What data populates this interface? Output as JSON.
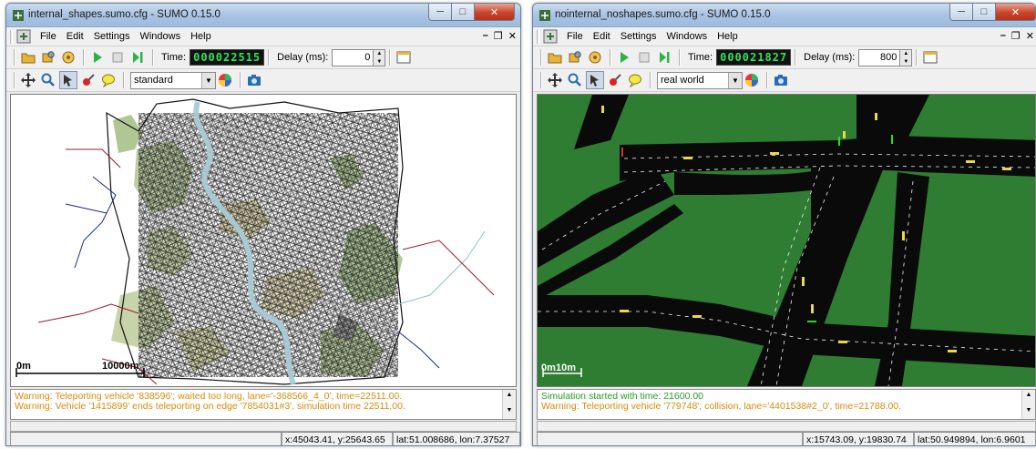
{
  "windows": [
    {
      "title": "internal_shapes.sumo.cfg - SUMO 0.15.0",
      "menu": [
        "File",
        "Edit",
        "Settings",
        "Windows",
        "Help"
      ],
      "time_label": "Time:",
      "time_value": "000022515",
      "delay_label": "Delay (ms):",
      "delay_value": "0",
      "scheme": "standard",
      "scale_start": "0m",
      "scale_end": "10000m",
      "messages": [
        {
          "type": "warn",
          "text": "Warning: Teleporting vehicle '838596'; waited too long, lane='-368566_4_0', time=22511.00."
        },
        {
          "type": "warn",
          "text": "Warning: Vehicle '1415899' ends teleporting on edge '7854031#3', simulation time 22511.00."
        }
      ],
      "status_xy": "x:45043.41, y:25643.65",
      "status_latlon": "lat:51.008686, lon:7.37527"
    },
    {
      "title": "nointernal_noshapes.sumo.cfg - SUMO 0.15.0",
      "menu": [
        "File",
        "Edit",
        "Settings",
        "Windows",
        "Help"
      ],
      "time_label": "Time:",
      "time_value": "000021827",
      "delay_label": "Delay (ms):",
      "delay_value": "800",
      "scheme": "real world",
      "scale_start": "0m",
      "scale_end": "10m",
      "messages": [
        {
          "type": "ok",
          "text": "Simulation started with time: 21600.00"
        },
        {
          "type": "warn",
          "text": "Warning: Teleporting vehicle '779748'; collision, lane='4401538#2_0', time=21788.00."
        }
      ],
      "status_xy": "x:15743.09, y:19830.74",
      "status_latlon": "lat:50.949894, lon:6.9601"
    }
  ],
  "colors": {
    "warning": "#d98b0b",
    "ok": "#2a9a2a",
    "grass": "#2e7d32",
    "road": "#0a0a0a",
    "lcd": "#31e25f"
  },
  "icons": [
    "sumo-app-icon",
    "open-icon",
    "reload-icon",
    "close-sim-icon",
    "run-icon",
    "stop-icon",
    "step-icon",
    "new-view-icon",
    "recenter-icon",
    "locate-icon",
    "select-icon",
    "edit-icon",
    "tooltip-icon",
    "color-wheel-icon",
    "screenshot-icon"
  ]
}
